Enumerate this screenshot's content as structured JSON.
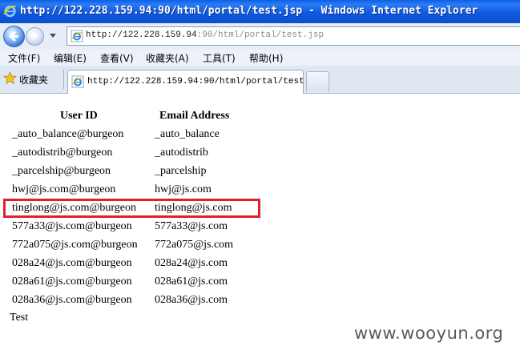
{
  "window": {
    "title": "http://122.228.159.94:90/html/portal/test.jsp - Windows Internet Explorer"
  },
  "address_bar": {
    "host": "http://122.228.159.94",
    "rest": ":90/html/portal/test.jsp"
  },
  "menu": {
    "items": [
      "文件(F)",
      "编辑(E)",
      "查看(V)",
      "收藏夹(A)",
      "工具(T)",
      "帮助(H)"
    ]
  },
  "favorites": {
    "label": "收藏夹"
  },
  "tab": {
    "title": "http://122.228.159.94:90/html/portal/test..."
  },
  "table": {
    "headers": [
      "User ID",
      "Email Address"
    ],
    "rows": [
      [
        "_auto_balance@burgeon",
        "_auto_balance"
      ],
      [
        "_autodistrib@burgeon",
        "_autodistrib"
      ],
      [
        "_parcelship@burgeon",
        "_parcelship"
      ],
      [
        "hwj@js.com@burgeon",
        "hwj@js.com"
      ],
      [
        "tinglong@js.com@burgeon",
        "tinglong@js.com"
      ],
      [
        "577a33@js.com@burgeon",
        "577a33@js.com"
      ],
      [
        "772a075@js.com@burgeon",
        "772a075@js.com"
      ],
      [
        "028a24@js.com@burgeon",
        "028a24@js.com"
      ],
      [
        "028a61@js.com@burgeon",
        "028a61@js.com"
      ],
      [
        "028a36@js.com@burgeon",
        "028a36@js.com"
      ]
    ]
  },
  "footer_text": "Test",
  "watermark": "www.wooyun.org",
  "colors": {
    "titlebar": "#0a5fe6",
    "highlight": "#e0202a"
  }
}
